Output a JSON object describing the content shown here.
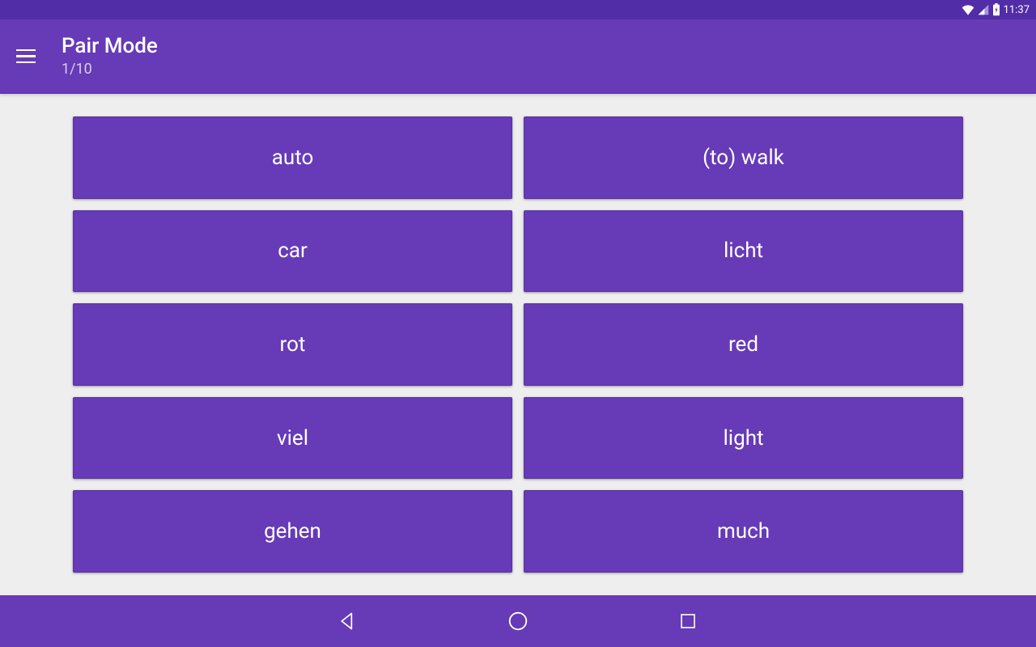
{
  "status_bar": {
    "time": "11:37"
  },
  "app_bar": {
    "title": "Pair Mode",
    "subtitle": "1/10"
  },
  "cards": {
    "left": [
      "auto",
      "car",
      "rot",
      "viel",
      "gehen"
    ],
    "right": [
      "(to) walk",
      "licht",
      "red",
      "light",
      "much"
    ]
  },
  "colors": {
    "primary": "#673AB7",
    "primary_dark": "#512DA8",
    "background": "#eeeeee"
  }
}
